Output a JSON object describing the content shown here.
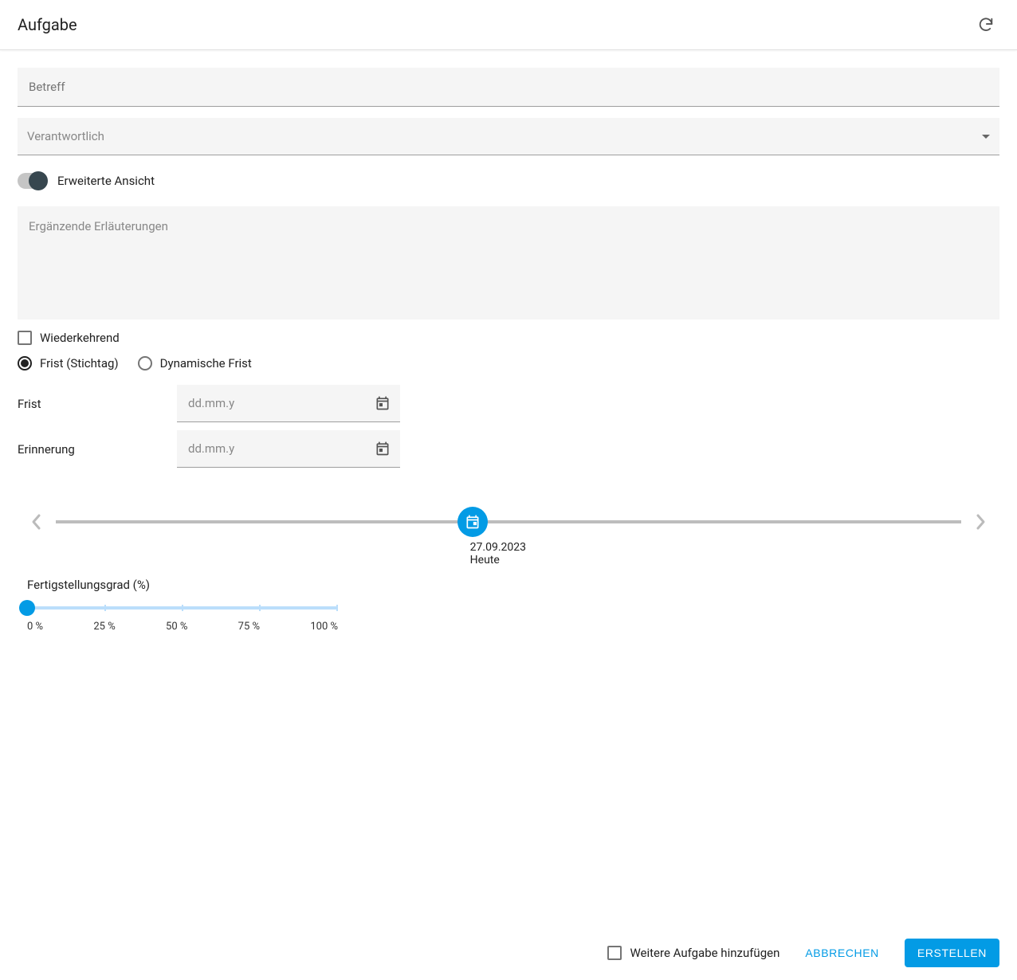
{
  "header": {
    "title": "Aufgabe"
  },
  "form": {
    "subject_placeholder": "Betreff",
    "responsible_placeholder": "Verantwortlich",
    "extended_view_label": "Erweiterte Ansicht",
    "extended_view_on": true,
    "notes_placeholder": "Ergänzende Erläuterungen",
    "recurring_label": "Wiederkehrend",
    "deadline_mode": {
      "fixed_label": "Frist (Stichtag)",
      "dynamic_label": "Dynamische Frist",
      "selected": "fixed"
    },
    "dates": {
      "deadline_label": "Frist",
      "reminder_label": "Erinnerung",
      "placeholder": "dd.mm.y"
    },
    "timeline": {
      "today_date": "27.09.2023",
      "today_label": "Heute"
    },
    "progress": {
      "label": "Fertigstellungsgrad (%)",
      "value": 0,
      "ticks": [
        "0 %",
        "25 %",
        "50 %",
        "75 %",
        "100 %"
      ]
    }
  },
  "footer": {
    "add_another_label": "Weitere Aufgabe hinzufügen",
    "cancel_label": "ABBRECHEN",
    "create_label": "ERSTELLEN"
  }
}
